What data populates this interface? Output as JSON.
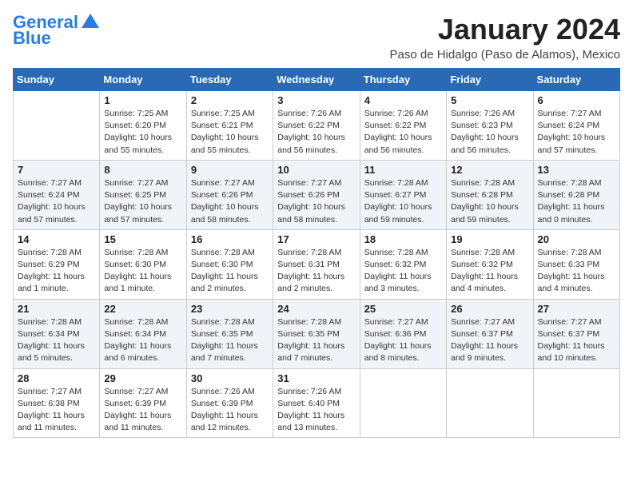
{
  "header": {
    "logo_line1": "General",
    "logo_line2": "Blue",
    "month": "January 2024",
    "location": "Paso de Hidalgo (Paso de Alamos), Mexico"
  },
  "weekdays": [
    "Sunday",
    "Monday",
    "Tuesday",
    "Wednesday",
    "Thursday",
    "Friday",
    "Saturday"
  ],
  "weeks": [
    [
      {
        "num": "",
        "info": ""
      },
      {
        "num": "1",
        "info": "Sunrise: 7:25 AM\nSunset: 6:20 PM\nDaylight: 10 hours\nand 55 minutes."
      },
      {
        "num": "2",
        "info": "Sunrise: 7:25 AM\nSunset: 6:21 PM\nDaylight: 10 hours\nand 55 minutes."
      },
      {
        "num": "3",
        "info": "Sunrise: 7:26 AM\nSunset: 6:22 PM\nDaylight: 10 hours\nand 56 minutes."
      },
      {
        "num": "4",
        "info": "Sunrise: 7:26 AM\nSunset: 6:22 PM\nDaylight: 10 hours\nand 56 minutes."
      },
      {
        "num": "5",
        "info": "Sunrise: 7:26 AM\nSunset: 6:23 PM\nDaylight: 10 hours\nand 56 minutes."
      },
      {
        "num": "6",
        "info": "Sunrise: 7:27 AM\nSunset: 6:24 PM\nDaylight: 10 hours\nand 57 minutes."
      }
    ],
    [
      {
        "num": "7",
        "info": "Sunrise: 7:27 AM\nSunset: 6:24 PM\nDaylight: 10 hours\nand 57 minutes."
      },
      {
        "num": "8",
        "info": "Sunrise: 7:27 AM\nSunset: 6:25 PM\nDaylight: 10 hours\nand 57 minutes."
      },
      {
        "num": "9",
        "info": "Sunrise: 7:27 AM\nSunset: 6:26 PM\nDaylight: 10 hours\nand 58 minutes."
      },
      {
        "num": "10",
        "info": "Sunrise: 7:27 AM\nSunset: 6:26 PM\nDaylight: 10 hours\nand 58 minutes."
      },
      {
        "num": "11",
        "info": "Sunrise: 7:28 AM\nSunset: 6:27 PM\nDaylight: 10 hours\nand 59 minutes."
      },
      {
        "num": "12",
        "info": "Sunrise: 7:28 AM\nSunset: 6:28 PM\nDaylight: 10 hours\nand 59 minutes."
      },
      {
        "num": "13",
        "info": "Sunrise: 7:28 AM\nSunset: 6:28 PM\nDaylight: 11 hours\nand 0 minutes."
      }
    ],
    [
      {
        "num": "14",
        "info": "Sunrise: 7:28 AM\nSunset: 6:29 PM\nDaylight: 11 hours\nand 1 minute."
      },
      {
        "num": "15",
        "info": "Sunrise: 7:28 AM\nSunset: 6:30 PM\nDaylight: 11 hours\nand 1 minute."
      },
      {
        "num": "16",
        "info": "Sunrise: 7:28 AM\nSunset: 6:30 PM\nDaylight: 11 hours\nand 2 minutes."
      },
      {
        "num": "17",
        "info": "Sunrise: 7:28 AM\nSunset: 6:31 PM\nDaylight: 11 hours\nand 2 minutes."
      },
      {
        "num": "18",
        "info": "Sunrise: 7:28 AM\nSunset: 6:32 PM\nDaylight: 11 hours\nand 3 minutes."
      },
      {
        "num": "19",
        "info": "Sunrise: 7:28 AM\nSunset: 6:32 PM\nDaylight: 11 hours\nand 4 minutes."
      },
      {
        "num": "20",
        "info": "Sunrise: 7:28 AM\nSunset: 6:33 PM\nDaylight: 11 hours\nand 4 minutes."
      }
    ],
    [
      {
        "num": "21",
        "info": "Sunrise: 7:28 AM\nSunset: 6:34 PM\nDaylight: 11 hours\nand 5 minutes."
      },
      {
        "num": "22",
        "info": "Sunrise: 7:28 AM\nSunset: 6:34 PM\nDaylight: 11 hours\nand 6 minutes."
      },
      {
        "num": "23",
        "info": "Sunrise: 7:28 AM\nSunset: 6:35 PM\nDaylight: 11 hours\nand 7 minutes."
      },
      {
        "num": "24",
        "info": "Sunrise: 7:28 AM\nSunset: 6:35 PM\nDaylight: 11 hours\nand 7 minutes."
      },
      {
        "num": "25",
        "info": "Sunrise: 7:27 AM\nSunset: 6:36 PM\nDaylight: 11 hours\nand 8 minutes."
      },
      {
        "num": "26",
        "info": "Sunrise: 7:27 AM\nSunset: 6:37 PM\nDaylight: 11 hours\nand 9 minutes."
      },
      {
        "num": "27",
        "info": "Sunrise: 7:27 AM\nSunset: 6:37 PM\nDaylight: 11 hours\nand 10 minutes."
      }
    ],
    [
      {
        "num": "28",
        "info": "Sunrise: 7:27 AM\nSunset: 6:38 PM\nDaylight: 11 hours\nand 11 minutes."
      },
      {
        "num": "29",
        "info": "Sunrise: 7:27 AM\nSunset: 6:39 PM\nDaylight: 11 hours\nand 11 minutes."
      },
      {
        "num": "30",
        "info": "Sunrise: 7:26 AM\nSunset: 6:39 PM\nDaylight: 11 hours\nand 12 minutes."
      },
      {
        "num": "31",
        "info": "Sunrise: 7:26 AM\nSunset: 6:40 PM\nDaylight: 11 hours\nand 13 minutes."
      },
      {
        "num": "",
        "info": ""
      },
      {
        "num": "",
        "info": ""
      },
      {
        "num": "",
        "info": ""
      }
    ]
  ]
}
